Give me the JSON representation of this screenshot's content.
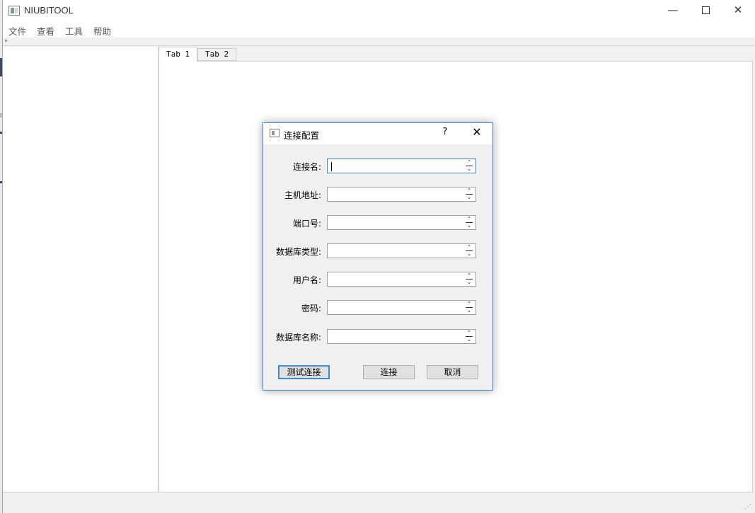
{
  "window": {
    "title": "NIUBITOOL",
    "controls": {
      "minimize": "—",
      "maximize": "",
      "close": "✕"
    }
  },
  "menu": {
    "items": [
      "文件",
      "查看",
      "工具",
      "帮助"
    ]
  },
  "tabs": [
    {
      "label": "Tab 1",
      "active": true
    },
    {
      "label": "Tab 2",
      "active": false
    }
  ],
  "dialog": {
    "title": "连接配置",
    "help": "?",
    "close": "✕",
    "fields": [
      {
        "label": "连接名:",
        "value": ""
      },
      {
        "label": "主机地址:",
        "value": ""
      },
      {
        "label": "端口号:",
        "value": ""
      },
      {
        "label": "数据库类型:",
        "value": ""
      },
      {
        "label": "用户名:",
        "value": ""
      },
      {
        "label": "密码:",
        "value": ""
      },
      {
        "label": "数据库名称:",
        "value": ""
      }
    ],
    "buttons": {
      "test": "测试连接",
      "connect": "连接",
      "cancel": "取消"
    }
  }
}
